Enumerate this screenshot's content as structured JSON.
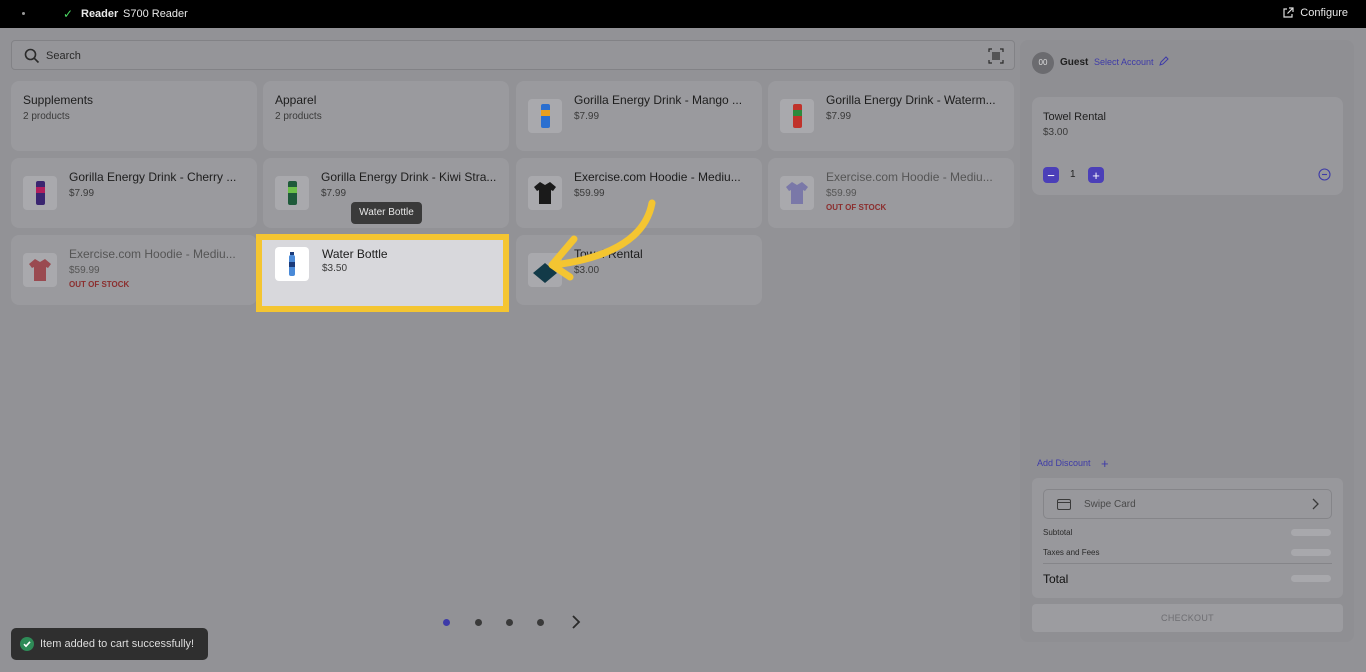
{
  "topbar": {
    "reader_label": "Reader",
    "reader_model": "S700 Reader",
    "configure_label": "Configure"
  },
  "search": {
    "placeholder": "Search"
  },
  "tiles": [
    {
      "name": "Supplements",
      "sub": "2 products"
    },
    {
      "name": "Apparel",
      "sub": "2 products"
    },
    {
      "name": "Gorilla Energy Drink - Mango ...",
      "price": "$7.99"
    },
    {
      "name": "Gorilla Energy Drink - Waterm...",
      "price": "$7.99"
    },
    {
      "name": "Gorilla Energy Drink - Cherry ...",
      "price": "$7.99"
    },
    {
      "name": "Gorilla Energy Drink - Kiwi Stra...",
      "price": "$7.99"
    },
    {
      "name": "Exercise.com Hoodie - Mediu...",
      "price": "$59.99"
    },
    {
      "name": "Exercise.com Hoodie - Mediu...",
      "price": "$59.99",
      "status": "OUT OF STOCK"
    },
    {
      "name": "Exercise.com Hoodie - Mediu...",
      "price": "$59.99",
      "status": "OUT OF STOCK"
    },
    {
      "name": "Water Bottle",
      "price": "$3.50"
    },
    {
      "name": "Towel Rental",
      "price": "$3.00"
    }
  ],
  "tooltip": "Water Bottle",
  "toast": "Item added to cart successfully!",
  "cart": {
    "avatar_initials": "00",
    "customer": "Guest",
    "select_account": "Select Account",
    "items": [
      {
        "name": "Towel Rental",
        "price": "$3.00",
        "qty": "1"
      }
    ],
    "add_discount": "Add Discount",
    "swipe_card": "Swipe Card",
    "subtotal_label": "Subtotal",
    "taxes_label": "Taxes and Fees",
    "total_label": "Total",
    "checkout_label": "CHECKOUT"
  },
  "colors": {
    "accent": "#4b3fb8",
    "highlight": "#f4c531",
    "out_of_stock": "#8b2e2e"
  }
}
